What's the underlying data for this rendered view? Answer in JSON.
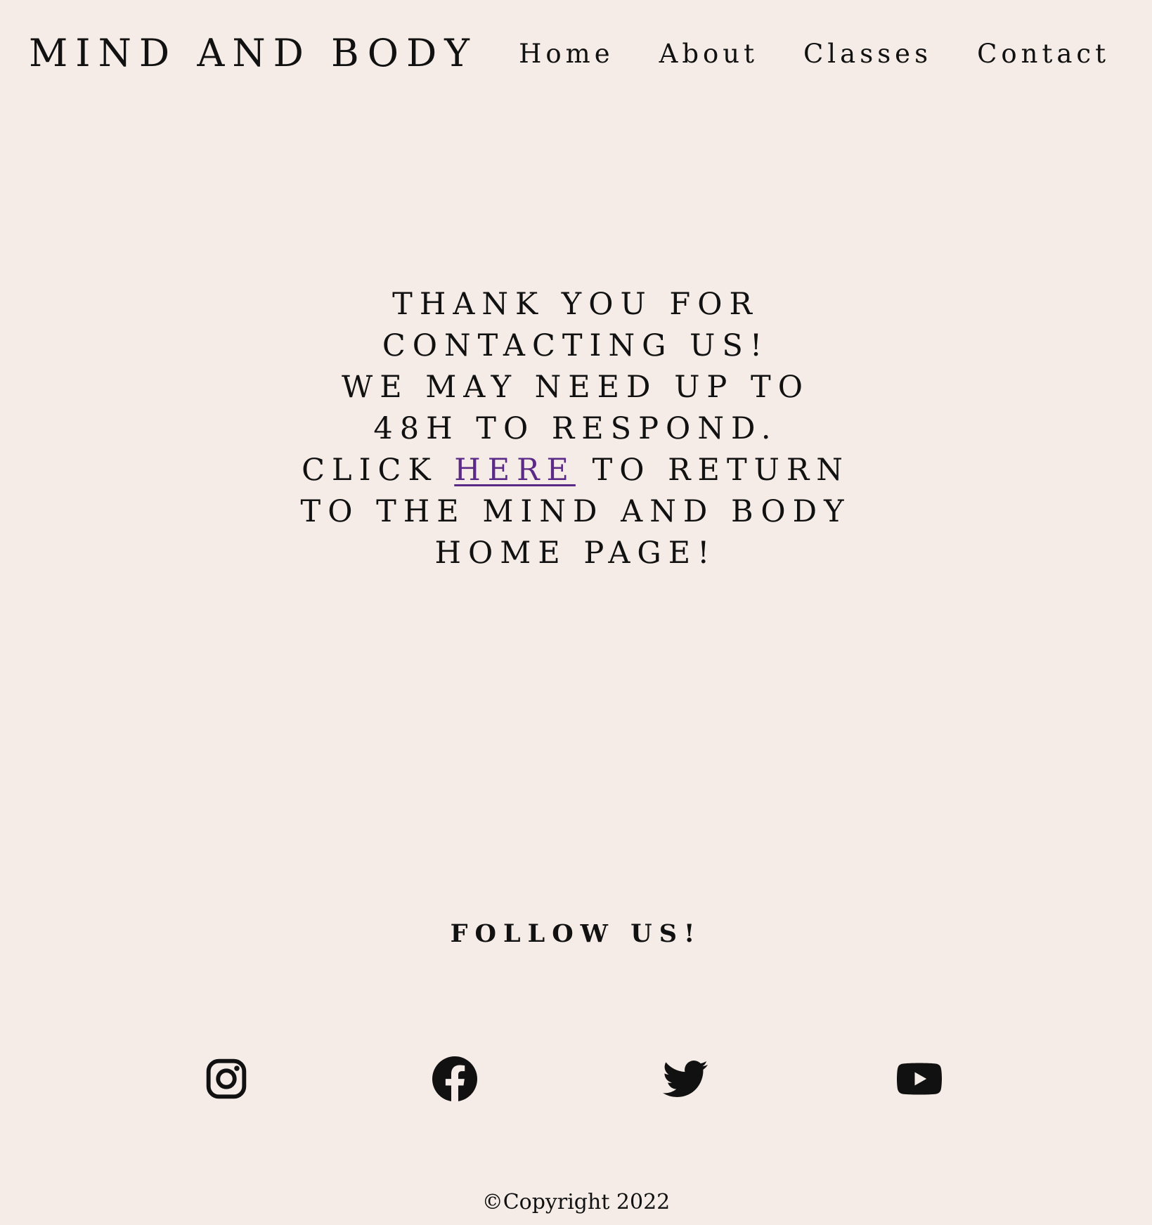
{
  "header": {
    "brand": "MIND AND BODY",
    "nav": [
      "Home",
      "About",
      "Classes",
      "Contact"
    ]
  },
  "message": {
    "line1": "THANK YOU FOR",
    "line2": "CONTACTING US!",
    "line3": "WE MAY NEED UP TO",
    "line4": "48H TO RESPOND.",
    "line5_before": "CLICK ",
    "link_text": "HERE",
    "line5_after": " TO RETURN",
    "line6": "TO THE MIND AND BODY",
    "line7": "HOME PAGE!"
  },
  "follow": {
    "heading": "FOLLOW US!",
    "icons": [
      "instagram-icon",
      "facebook-icon",
      "twitter-icon",
      "youtube-icon"
    ]
  },
  "footer": {
    "copyright": "©Copyright 2022"
  },
  "colors": {
    "background": "#f5ece7",
    "text": "#111111",
    "link": "#5a2a86"
  }
}
